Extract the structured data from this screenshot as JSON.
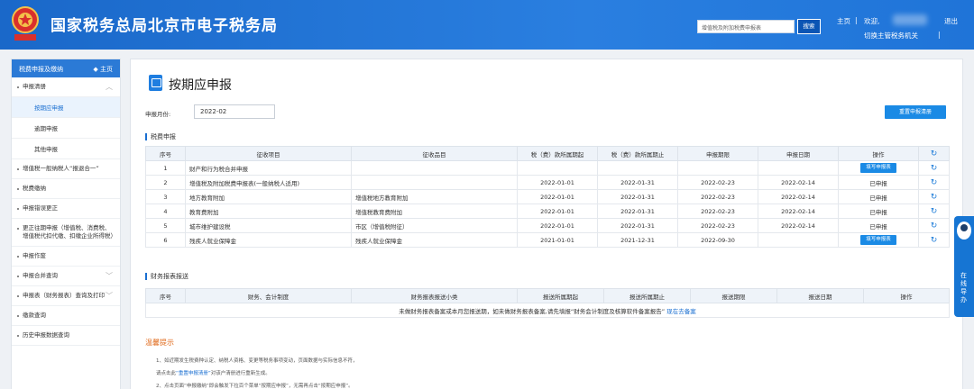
{
  "header": {
    "site_title": "国家税务总局北京市电子税务局",
    "search_placeholder": "增值税及附加税费申报表",
    "search_button": "搜索",
    "home": "主页",
    "separator": "|",
    "welcome": "欢迎,",
    "switch_org": "切换主管税务机关",
    "bar": "|",
    "logout": "退出"
  },
  "sidebar": {
    "head_title": "税费申报及缴纳",
    "head_home": "◆ 主页",
    "items": [
      {
        "label": "申报清册",
        "expandable": true
      },
      {
        "label": "按期应申报",
        "sub": true,
        "active": true
      },
      {
        "label": "逾期申报",
        "sub": true
      },
      {
        "label": "其他申报",
        "sub": true
      },
      {
        "label": "增值税一般纳税人“报退合一”"
      },
      {
        "label": "税费缴纳"
      },
      {
        "label": "申报错误更正"
      },
      {
        "label": "更正往期申报（增值税、消费税、增值税代扣代缴、扣缴企业所得税）"
      },
      {
        "label": "申报作废"
      },
      {
        "label": "申报合并查询",
        "expandable": true
      },
      {
        "label": "申报表（财务报表）查询及打印",
        "expandable": true
      },
      {
        "label": "缴款查询"
      },
      {
        "label": "历史申报数据查询"
      }
    ]
  },
  "main": {
    "title": "按期应申报",
    "period_label": "申报月份:",
    "period_value": "2022-02",
    "reset_button": "重置申报清册",
    "tax_section": "税费申报",
    "tax_headers": [
      "序号",
      "征收项目",
      "征收品目",
      "税（费）款所属期起",
      "税（费）款所属期止",
      "申报期限",
      "申报日期",
      "操作",
      "↻"
    ],
    "tax_rows": [
      {
        "no": "1",
        "item": "财产和行为税合并申报",
        "sub": "",
        "start": "",
        "end": "",
        "deadline": "",
        "date": "",
        "op": "填写申报表",
        "op_button": true
      },
      {
        "no": "2",
        "item": "增值税及附加税费申报表(一般纳税人适用)",
        "sub": "",
        "start": "2022-01-01",
        "end": "2022-01-31",
        "deadline": "2022-02-23",
        "date": "2022-02-14",
        "op": "已申报",
        "op_button": false
      },
      {
        "no": "3",
        "item": "地方教育附加",
        "sub": "增值税地方教育附加",
        "start": "2022-01-01",
        "end": "2022-01-31",
        "deadline": "2022-02-23",
        "date": "2022-02-14",
        "op": "已申报",
        "op_button": false
      },
      {
        "no": "4",
        "item": "教育费附加",
        "sub": "增值税教育费附加",
        "start": "2022-01-01",
        "end": "2022-01-31",
        "deadline": "2022-02-23",
        "date": "2022-02-14",
        "op": "已申报",
        "op_button": false
      },
      {
        "no": "5",
        "item": "城市维护建设税",
        "sub": "市区（增值税附征）",
        "start": "2022-01-01",
        "end": "2022-01-31",
        "deadline": "2022-02-23",
        "date": "2022-02-14",
        "op": "已申报",
        "op_button": false
      },
      {
        "no": "6",
        "item": "残疾人就业保障金",
        "sub": "残疾人就业保障金",
        "start": "2021-01-01",
        "end": "2021-12-31",
        "deadline": "2022-09-30",
        "date": "",
        "op": "填写申报表",
        "op_button": true
      }
    ],
    "fin_section": "财务报表报送",
    "fin_headers": [
      "序号",
      "财务、会计制度",
      "财务报表报送小类",
      "报送所属期起",
      "报送所属期止",
      "报送期限",
      "报送日期",
      "操作"
    ],
    "fin_empty": "未做财务报表备案或本月您报送期，如未做财务报表备案,请先填报“财务会计制度及核算软件备案报告”",
    "fin_empty_link": "现在去备案",
    "notice_title": "温馨提示",
    "notice_1": "1、如近期发生税费种认定、纳税人资格、变更等税务事项变动，页面数据与实际信息不符，",
    "notice_2a": "请点击此",
    "notice_2_link": "“重置申报清册”",
    "notice_2b": "对该户清册进行重新生成。",
    "notice_3": "2、点击页面“申报缴纳”即会触发下拉百个菜单“按期应申报”，无需再点击“按期应申报”。"
  },
  "float_help": {
    "text": "在线导办"
  },
  "colors": {
    "header": "#2a7fe0",
    "accent": "#1a8ae5",
    "notice": "#e06a1b"
  }
}
